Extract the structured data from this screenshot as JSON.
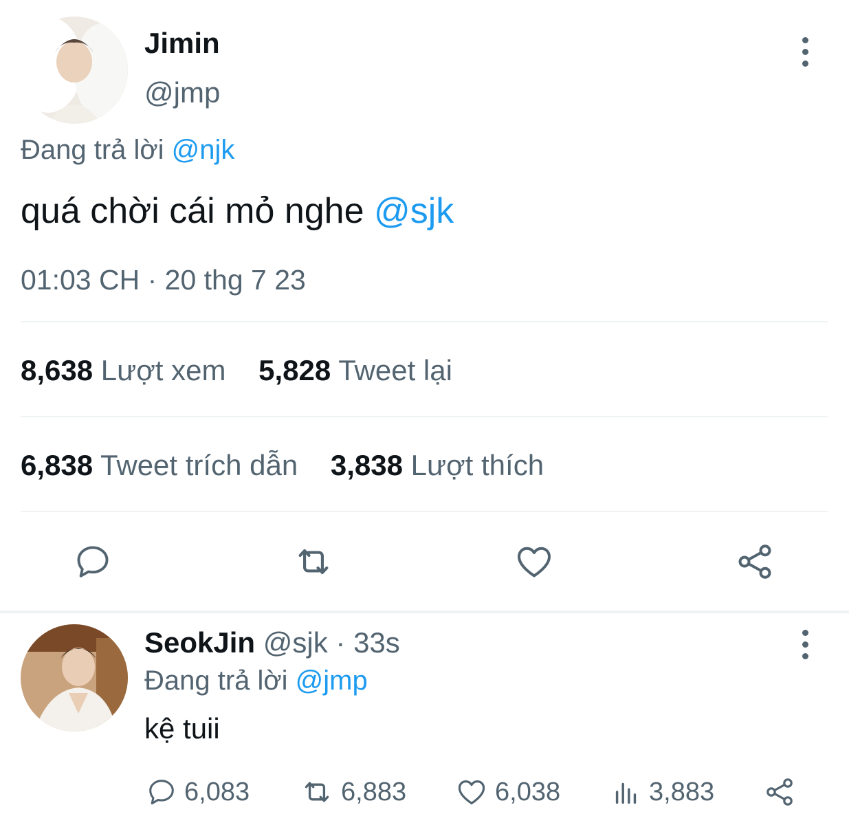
{
  "main_tweet": {
    "author": {
      "display_name": "Jimin",
      "handle": "@jmp"
    },
    "reply_prefix": "Đang trả lời",
    "reply_to": "@njk",
    "text": "quá chời cái mỏ nghe",
    "text_mention": "@sjk",
    "timestamp": "01:03 CH · 20 thg 7 23",
    "stats": {
      "views_count": "8,638",
      "views_label": "Lượt xem",
      "retweets_count": "5,828",
      "retweets_label": "Tweet lại",
      "quotes_count": "6,838",
      "quotes_label": "Tweet trích dẫn",
      "likes_count": "3,838",
      "likes_label": "Lượt thích"
    },
    "actions": [
      "reply-icon",
      "retweet-icon",
      "like-icon",
      "share-icon"
    ]
  },
  "reply_tweet": {
    "author": {
      "display_name": "SeokJin",
      "handle": "@sjk"
    },
    "separator": "·",
    "time_ago": "33s",
    "reply_prefix": "Đang trả lời",
    "reply_to": "@jmp",
    "text": "kệ tuii",
    "counts": {
      "replies": "6,083",
      "retweets": "6,883",
      "likes": "6,038",
      "views": "3,883"
    }
  },
  "colors": {
    "text_primary": "#0f1419",
    "text_secondary": "#536471",
    "link": "#1d9bf0",
    "divider": "#eff3f4"
  }
}
